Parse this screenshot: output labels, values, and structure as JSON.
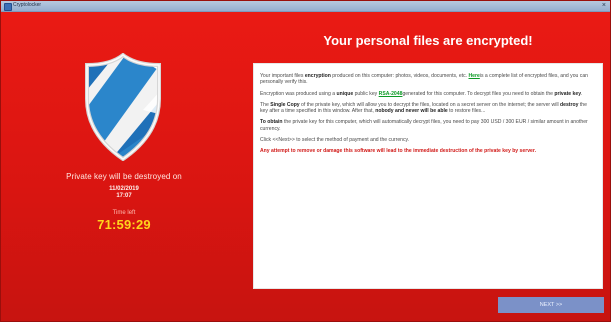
{
  "window": {
    "title": "Cryptolocker",
    "close_icon": "close-icon"
  },
  "left_panel": {
    "shield_icon": "shield-icon",
    "destroy_label": "Private key will be destroyed on",
    "destroy_date": "11/02/2019",
    "destroy_time": "17:07",
    "time_left_label": "Time left",
    "countdown": "71:59:29"
  },
  "main": {
    "heading": "Your personal files are encrypted!",
    "message": {
      "p1_prefix": "Your important files ",
      "p1_strong": "encryption",
      "p1_middle": " produced on this computer: photos, videos, documents, etc. ",
      "p1_link": "Here",
      "p1_suffix": "is a complete list of encrypted files, and you can personally verify this.",
      "p2_prefix": "Encryption was produced using a ",
      "p2_strong": "unique",
      "p2_middle": " public key ",
      "p2_link": "RSA-2048",
      "p2_suffix_1": "generated for this computer. To decrypt files you need to obtain the ",
      "p2_strong_2": "private key",
      "p2_suffix_2": ".",
      "p3_prefix": "The ",
      "p3_strong_1": "Single Copy",
      "p3_middle_1": " of the private key, which will allow you to decrypt the files, located on a secret server on the internet; the server will ",
      "p3_strong_2": "destroy",
      "p3_middle_2": " the key after a time specified in this window. After that, ",
      "p3_strong_3": "nobody and never will be able",
      "p3_suffix": " to restore files...",
      "p4_strong": "To obtain",
      "p4_text": " the private key for this computer, which will automatically decrypt files, you need to pay 300 USD / 300 EUR / similar amount in another currency.",
      "p5": "Click <<Next>> to select the method of payment and the currency.",
      "p6": "Any attempt to remove or damage this software will lead to the immediate destruction of the private key by server."
    }
  },
  "actions": {
    "next": "NEXT >>"
  },
  "colors": {
    "background": "#d61511",
    "countdown": "#ffd51c",
    "link": "#0c9a25",
    "warning": "#d11a18",
    "next_button": "#7b91c8"
  }
}
